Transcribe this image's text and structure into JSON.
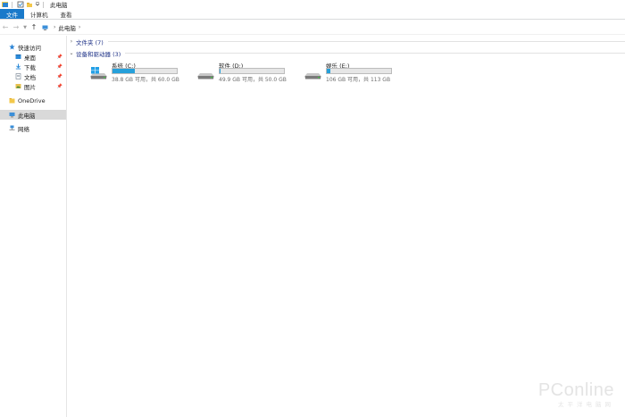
{
  "window": {
    "title": "此电脑"
  },
  "ribbon": {
    "tabs": [
      {
        "label": "文件",
        "active": true
      },
      {
        "label": "计算机"
      },
      {
        "label": "查看"
      }
    ]
  },
  "address": {
    "crumbs": [
      "此电脑"
    ]
  },
  "sidebar": {
    "quick_access": "快速访问",
    "pinned": [
      "桌面",
      "下载",
      "文档",
      "图片"
    ],
    "onedrive": "OneDrive",
    "this_pc": "此电脑",
    "network": "网络"
  },
  "content": {
    "groups": [
      {
        "label": "文件夹 (7)",
        "expanded": false
      },
      {
        "label": "设备和驱动器 (3)",
        "expanded": true
      }
    ],
    "drives": [
      {
        "name": "系统 (C:)",
        "info": "38.8 GB 可用，共 60.0 GB",
        "used_fraction": 0.35,
        "is_system": true
      },
      {
        "name": "软件 (D:)",
        "info": "49.9 GB 可用，共 50.0 GB",
        "used_fraction": 0.002,
        "is_system": false
      },
      {
        "name": "娱乐 (E:)",
        "info": "106 GB 可用，共 113 GB",
        "used_fraction": 0.062,
        "is_system": false
      }
    ]
  },
  "watermark": {
    "logo": "PConline",
    "sub": "太平洋电脑网"
  },
  "colors": {
    "accent": "#1979ca",
    "drive_fill": "#26a0da",
    "group_text": "#1e3287"
  }
}
